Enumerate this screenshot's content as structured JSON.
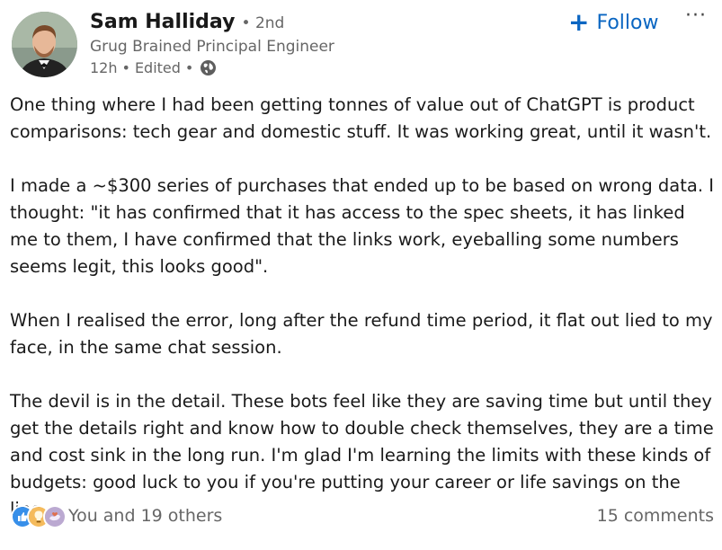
{
  "author": {
    "name": "Sam Halliday",
    "degree": "• 2nd",
    "headline": "Grug Brained Principal Engineer",
    "time": "12h",
    "edited": "Edited",
    "visibility_icon": "globe-icon"
  },
  "actions": {
    "follow_label": "Follow",
    "more_label": "···"
  },
  "post": {
    "paragraphs": [
      "One thing where I had been getting tonnes of value out of ChatGPT is product comparisons: tech gear and domestic stuff. It was working great, until it wasn't.",
      "I made a ~$300 series of purchases that ended up to be based on wrong data. I thought: \"it has confirmed that it has access to the spec sheets, it has linked me to them, I have confirmed that the links work, eyeballing some numbers seems legit, this looks good\".",
      "When I realised the error, long after the refund time period, it flat out lied to my face, in the same chat session.",
      "The devil is in the detail. These bots feel like they are saving time but until they get the details right and know how to double check themselves, they are a time and cost sink in the long run. I'm glad I'm learning the limits with these kinds of budgets: good luck to you if you're putting your career or life savings on the line."
    ]
  },
  "social": {
    "reactions_text": "You and 19 others",
    "comments_text": "15 comments",
    "reaction_icons": [
      "like-icon",
      "insightful-icon",
      "support-icon"
    ]
  },
  "colors": {
    "accent": "#0a66c2",
    "secondary_text": "#666666",
    "primary_text": "#1a1a1a"
  }
}
